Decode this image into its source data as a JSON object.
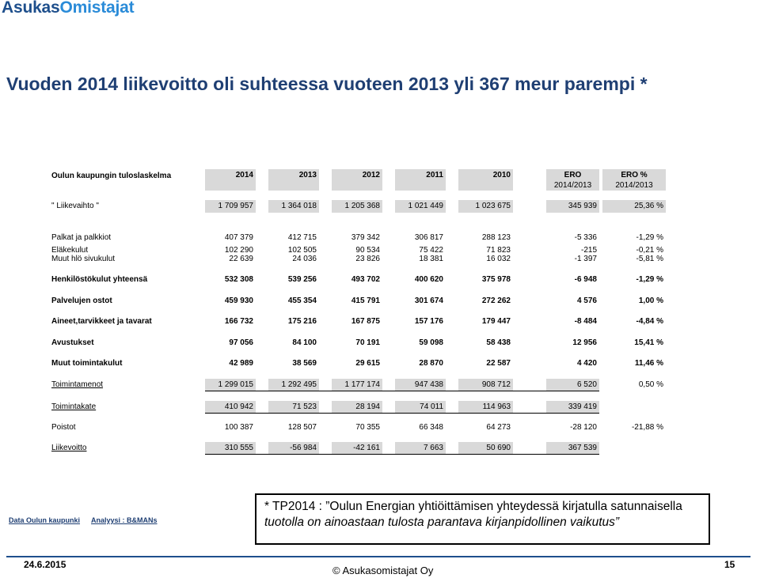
{
  "header": {
    "logo_part1": "Asukas",
    "logo_part2": "Omistajat",
    "title": "Vuoden 2014 liikevoitto oli suhteessa vuoteen 2013 yli 367 meur parempi *"
  },
  "table": {
    "heading": "Oulun kaupungin tuloslaskelma",
    "columns": [
      {
        "label": "2014",
        "sub": ""
      },
      {
        "label": "2013",
        "sub": ""
      },
      {
        "label": "2012",
        "sub": ""
      },
      {
        "label": "2011",
        "sub": ""
      },
      {
        "label": "2010",
        "sub": ""
      },
      {
        "label": "ERO",
        "sub": "2014/2013"
      },
      {
        "label": "ERO %",
        "sub": "2014/2013"
      }
    ],
    "rows": [
      {
        "label": "\" Liikevaihto \"",
        "values": [
          "1 709 957",
          "1 364 018",
          "1 205 368",
          "1 021 449",
          "1 023 675",
          "345 939",
          "25,36 %"
        ]
      },
      {
        "label": "Palkat ja palkkiot",
        "values": [
          "407 379",
          "412 715",
          "379 342",
          "306 817",
          "288 123",
          "-5 336",
          "-1,29 %"
        ]
      },
      {
        "label": "Eläkekulut",
        "values": [
          "102 290",
          "102 505",
          "90 534",
          "75 422",
          "71 823",
          "-215",
          "-0,21 %"
        ]
      },
      {
        "label": "Muut hlö sivukulut",
        "values": [
          "22 639",
          "24 036",
          "23 826",
          "18 381",
          "16 032",
          "-1 397",
          "-5,81 %"
        ]
      },
      {
        "label": "Henkilöstökulut yhteensä",
        "values": [
          "532 308",
          "539 256",
          "493 702",
          "400 620",
          "375 978",
          "-6 948",
          "-1,29 %"
        ]
      },
      {
        "label": "Palvelujen ostot",
        "values": [
          "459 930",
          "455 354",
          "415 791",
          "301 674",
          "272 262",
          "4 576",
          "1,00 %"
        ]
      },
      {
        "label": "Aineet,tarvikkeet ja tavarat",
        "values": [
          "166 732",
          "175 216",
          "167 875",
          "157 176",
          "179 447",
          "-8 484",
          "-4,84 %"
        ]
      },
      {
        "label": "Avustukset",
        "values": [
          "97 056",
          "84 100",
          "70 191",
          "59 098",
          "58 438",
          "12 956",
          "15,41 %"
        ]
      },
      {
        "label": "Muut toimintakulut",
        "values": [
          "42 989",
          "38 569",
          "29 615",
          "28 870",
          "22 587",
          "4 420",
          "11,46 %"
        ]
      },
      {
        "label": "Toimintamenot",
        "values": [
          "1 299 015",
          "1 292 495",
          "1 177 174",
          "947 438",
          "908 712",
          "6 520",
          "0,50 %"
        ]
      },
      {
        "label": "Toimintakate",
        "values": [
          "410 942",
          "71 523",
          "28 194",
          "74 011",
          "114 963",
          "339 419",
          ""
        ]
      },
      {
        "label": "Poistot",
        "values": [
          "100 387",
          "128 507",
          "70 355",
          "66 348",
          "64 273",
          "-28 120",
          "-21,88 %"
        ]
      },
      {
        "label": "Liikevoitto",
        "values": [
          "310 555",
          "-56 984",
          "-42 161",
          "7 663",
          "50 690",
          "367 539",
          ""
        ]
      }
    ]
  },
  "footer": {
    "source": "Data Oulun kaupunki",
    "analysis": "Analyysi : B&MANs",
    "note_line1": "* TP2014 : ”Oulun Energian yhtiöittämisen yhteydessä kirjatulla satunnaisella",
    "note_line2": "tuotolla on ainoastaan tulosta parantava kirjanpidollinen vaikutus”",
    "date": "24.6.2015",
    "copyright": "© Asukasomistajat Oy",
    "page": "15"
  }
}
